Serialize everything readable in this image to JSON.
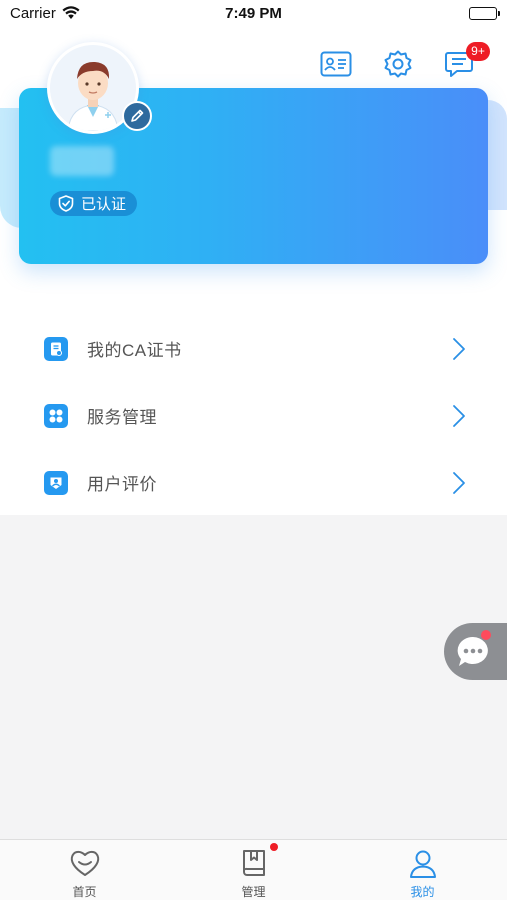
{
  "status_bar": {
    "carrier": "Carrier",
    "time": "7:49 PM"
  },
  "header": {
    "icons": [
      "id-card-icon",
      "settings-gear-icon",
      "message-icon"
    ],
    "message_badge": "9+"
  },
  "profile": {
    "name": "",
    "verified_label": "已认证"
  },
  "menu": {
    "items": [
      {
        "label": "我的CA证书",
        "icon": "certificate-icon"
      },
      {
        "label": "服务管理",
        "icon": "service-grid-icon"
      },
      {
        "label": "用户评价",
        "icon": "user-review-icon"
      }
    ]
  },
  "floating_button": {
    "icon": "chat-bubble-icon"
  },
  "tabbar": {
    "tabs": [
      {
        "label": "首页",
        "icon": "home-smile-icon",
        "active": false
      },
      {
        "label": "管理",
        "icon": "book-icon",
        "active": false
      },
      {
        "label": "我的",
        "icon": "person-icon",
        "active": true
      }
    ]
  },
  "colors": {
    "card_gradient_start": "#23c0f1",
    "card_gradient_end": "#4a8ef9",
    "accent": "#2a8fe6",
    "badge_red": "#ee1c25",
    "page_background": "#f4f4f5"
  }
}
